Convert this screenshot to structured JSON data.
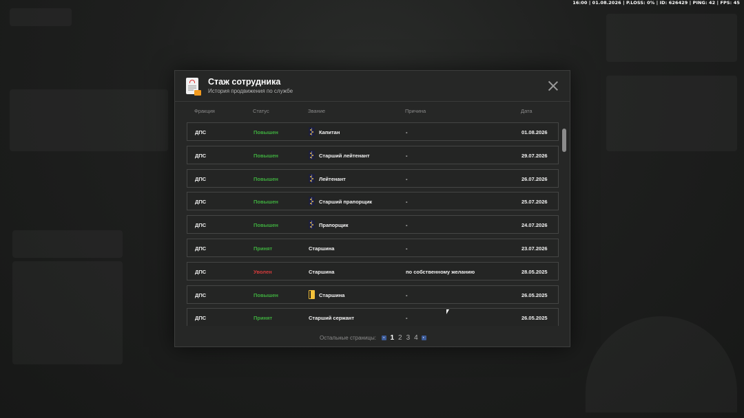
{
  "hud": {
    "status_line": "16:00 | 01.08.2026 | P.LOSS: 0% | ID: 626429 | PING: 42 | FPS: 45"
  },
  "modal": {
    "title": "Стаж сотрудника",
    "subtitle": "История продвижения по службе",
    "icon": "document-icon",
    "close_icon": "close-icon"
  },
  "columns": {
    "faction": "Фракция",
    "status": "Статус",
    "rank": "Звание",
    "reason": "Причина",
    "date": "Дата"
  },
  "rows": [
    {
      "faction": "ДПС",
      "status": "Повышен",
      "status_type": "promoted",
      "rank": "Капитан",
      "rank_icon": "epaulette-icon",
      "reason": "-",
      "date": "01.08.2026"
    },
    {
      "faction": "ДПС",
      "status": "Повышен",
      "status_type": "promoted",
      "rank": "Старший лейтенант",
      "rank_icon": "epaulette-icon",
      "reason": "-",
      "date": "29.07.2026"
    },
    {
      "faction": "ДПС",
      "status": "Повышен",
      "status_type": "promoted",
      "rank": "Лейтенант",
      "rank_icon": "epaulette-icon",
      "reason": "-",
      "date": "26.07.2026"
    },
    {
      "faction": "ДПС",
      "status": "Повышен",
      "status_type": "promoted",
      "rank": "Старший прапорщик",
      "rank_icon": "epaulette-icon",
      "reason": "-",
      "date": "25.07.2026"
    },
    {
      "faction": "ДПС",
      "status": "Повышен",
      "status_type": "promoted",
      "rank": "Прапорщик",
      "rank_icon": "epaulette-icon",
      "reason": "-",
      "date": "24.07.2026"
    },
    {
      "faction": "ДПС",
      "status": "Принят",
      "status_type": "accepted",
      "rank": "Старшина",
      "rank_icon": "",
      "reason": "-",
      "date": "23.07.2026"
    },
    {
      "faction": "ДПС",
      "status": "Уволен",
      "status_type": "fired",
      "rank": "Старшина",
      "rank_icon": "",
      "reason": "по собственному желанию",
      "date": "28.05.2025"
    },
    {
      "faction": "ДПС",
      "status": "Повышен",
      "status_type": "promoted",
      "rank": "Старшина",
      "rank_icon": "gold-epaulette-icon",
      "reason": "-",
      "date": "26.05.2025"
    },
    {
      "faction": "ДПС",
      "status": "Принят",
      "status_type": "accepted",
      "rank": "Старший сержант",
      "rank_icon": "",
      "reason": "-",
      "date": "26.05.2025"
    }
  ],
  "pager": {
    "label": "Остальные страницы:",
    "pages": [
      "1",
      "2",
      "3",
      "4"
    ],
    "current": "1"
  },
  "colors": {
    "promoted": "#3fae3f",
    "fired": "#d43b3b",
    "pager_arrow": "#3d5b96"
  }
}
